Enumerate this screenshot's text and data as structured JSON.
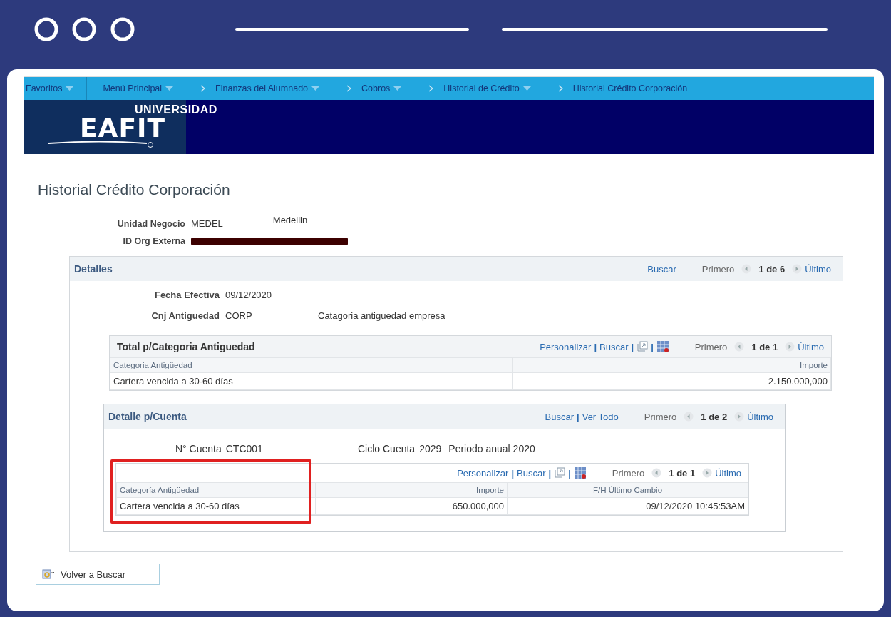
{
  "nav": [
    {
      "label": "Favoritos",
      "chevron": false,
      "dropdown": true
    },
    {
      "label": "Menú Principal",
      "chevron": false,
      "dropdown": true
    },
    {
      "label": "Finanzas del Alumnado",
      "chevron": true,
      "dropdown": true
    },
    {
      "label": "Cobros",
      "chevron": true,
      "dropdown": true
    },
    {
      "label": "Historial de Crédito",
      "chevron": true,
      "dropdown": true
    },
    {
      "label": "Historial Crédito Corporación",
      "chevron": true,
      "dropdown": false
    }
  ],
  "logo": {
    "line1": "UNIVERSIDAD",
    "line2": "EAFIT"
  },
  "page_title": "Historial Crédito Corporación",
  "header_fields": [
    {
      "label": "Unidad Negocio",
      "value": "MEDEL",
      "description": "Medellin",
      "redacted": false
    },
    {
      "label": "ID Org Externa",
      "redacted": true
    }
  ],
  "detalles": {
    "title": "Detalles",
    "links": [
      "Buscar"
    ],
    "first": "Primero",
    "count": "1 de 6",
    "last": "Último",
    "fields": [
      {
        "label": "Fecha Efectiva",
        "value": "09/12/2020"
      },
      {
        "label": "Cnj Antiguedad",
        "value": "CORP",
        "description": "Catagoria antiguedad empresa"
      }
    ],
    "total_grid": {
      "title": "Total p/Categoria Antiguedad",
      "links": [
        "Personalizar",
        "Buscar"
      ],
      "first": "Primero",
      "count": "1 de 1",
      "last": "Último",
      "separator": "|",
      "columns": [
        {
          "label": "Categoria Antigüedad",
          "highlighted": false
        },
        {
          "label": "Importe",
          "highlighted": false
        }
      ],
      "rows": [
        [
          "Cartera vencida a 30-60 días",
          "2.150.000,000"
        ]
      ]
    },
    "cuenta": {
      "title": "Detalle p/Cuenta",
      "links": [
        "Buscar",
        "Ver Todo"
      ],
      "separator": "|",
      "first": "Primero",
      "count": "1 de 2",
      "last": "Último",
      "fields": [
        {
          "label": "N° Cuenta",
          "value": "CTC001"
        },
        {
          "label": "Ciclo Cuenta",
          "value": "2029",
          "description": "Periodo anual 2020"
        }
      ],
      "grid": {
        "links": [
          "Personalizar",
          "Buscar"
        ],
        "first": "Primero",
        "count": "1 de 1",
        "last": "Último",
        "separator": "|",
        "columns": [
          {
            "label": "Categoría Antigüedad",
            "highlighted": true
          },
          {
            "label": "Importe",
            "highlighted": false
          },
          {
            "label": "F/H Último Cambio",
            "highlighted": false
          }
        ],
        "rows": [
          [
            "Cartera vencida a 30-60 días",
            "650.000,000",
            "09/12/2020 10:45:53AM"
          ]
        ]
      }
    }
  },
  "return_button": "Volver a Buscar"
}
